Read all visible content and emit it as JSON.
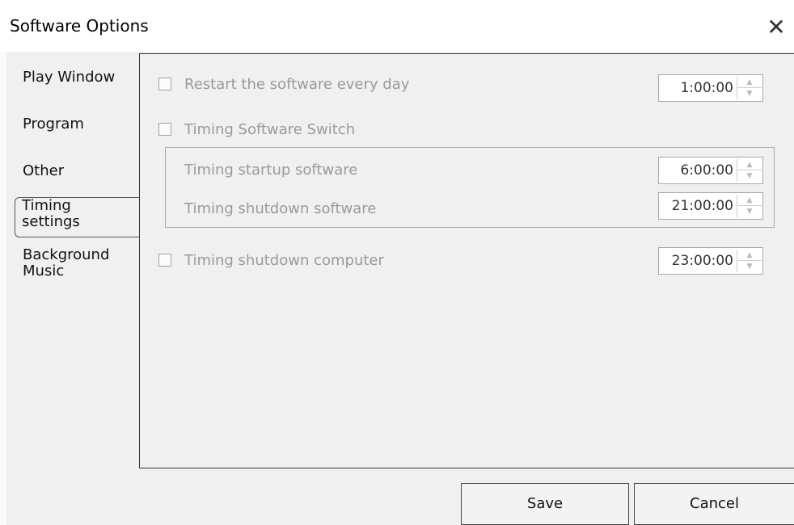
{
  "window": {
    "title": "Software Options",
    "close_glyph": "✕"
  },
  "tabs": [
    {
      "label": "Play Window"
    },
    {
      "label": "Program"
    },
    {
      "label": "Other"
    },
    {
      "label": "Timing\nsettings",
      "active": true
    },
    {
      "label": "Background\nMusic"
    }
  ],
  "settings": {
    "restart_daily": {
      "label": "Restart the software every day",
      "checked": false,
      "time": "1:00:00"
    },
    "timing_switch": {
      "label": "Timing Software Switch",
      "checked": false
    },
    "startup": {
      "label": "Timing startup software",
      "time": "6:00:00"
    },
    "shutdown_software": {
      "label": "Timing shutdown software",
      "time": "21:00:00"
    },
    "shutdown_computer": {
      "label": "Timing shutdown computer",
      "checked": false,
      "time": "23:00:00"
    }
  },
  "buttons": {
    "save": "Save",
    "cancel": "Cancel"
  },
  "icons": {
    "spin_up": "▲",
    "spin_down": "▼"
  }
}
